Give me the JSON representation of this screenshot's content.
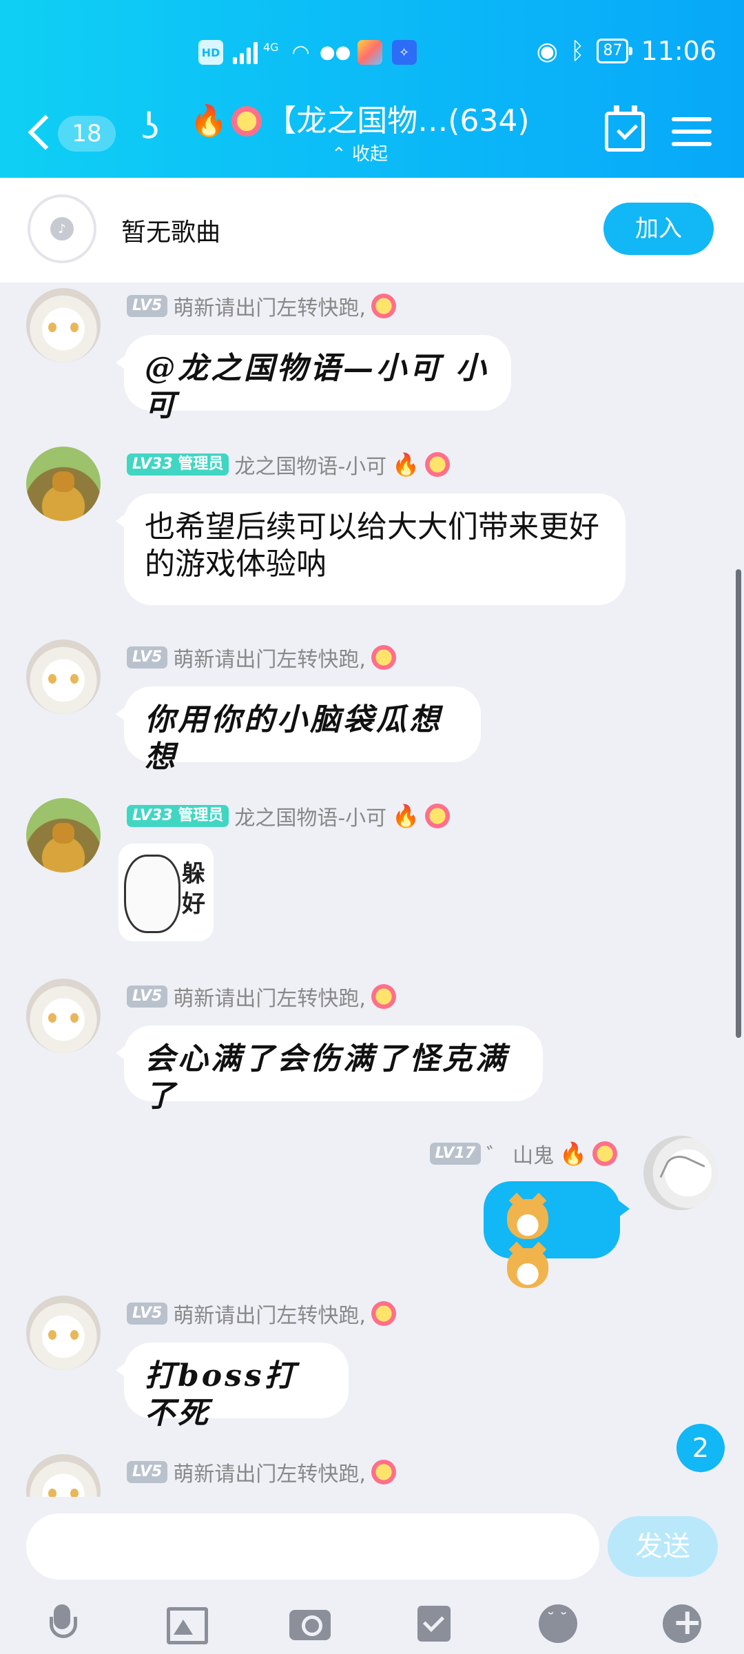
{
  "status_bar": {
    "time": "11:06",
    "battery": "87",
    "network": "4G",
    "hd_label": "HD"
  },
  "nav": {
    "unread_count": "18",
    "title": "【龙之国物…(634)",
    "subtitle": "收起"
  },
  "music": {
    "text": "暂无歌曲",
    "join_label": "加入"
  },
  "messages": [
    {
      "level": "LV5",
      "admin_label": "",
      "sender": "萌新请出门左转快跑,",
      "text": "@龙之国物语—小可 小可"
    },
    {
      "level": "LV33",
      "admin_label": "管理员",
      "sender": "龙之国物语-小可",
      "text": "也希望后续可以给大大们带来更好的游戏体验呐"
    },
    {
      "level": "LV5",
      "admin_label": "",
      "sender": "萌新请出门左转快跑,",
      "text": "你用你的小脑袋瓜想想"
    },
    {
      "level": "LV33",
      "admin_label": "管理员",
      "sender": "龙之国物语-小可",
      "sticker_text": "躲好"
    },
    {
      "level": "LV5",
      "admin_label": "",
      "sender": "萌新请出门左转快跑,",
      "text": "会心满了会伤满了怪克满了"
    },
    {
      "level": "LV17",
      "admin_label": "",
      "sender": "山鬼",
      "prefix": "゛",
      "mine": true
    },
    {
      "level": "LV5",
      "admin_label": "",
      "sender": "萌新请出门左转快跑,",
      "text": "打boss打不死"
    },
    {
      "level": "LV5",
      "admin_label": "",
      "sender": "萌新请出门左转快跑,"
    }
  ],
  "new_message_badge": "2",
  "composer": {
    "placeholder": "",
    "send_label": "发送"
  },
  "toolbar_icons": [
    "microphone-icon",
    "image-icon",
    "camera-icon",
    "red-packet-icon",
    "emoji-icon",
    "plus-icon"
  ],
  "colors": {
    "accent": "#12b7f5",
    "admin_badge": "#41d6c3",
    "level_badge": "#b9c1cc",
    "background": "#eef0f6"
  }
}
